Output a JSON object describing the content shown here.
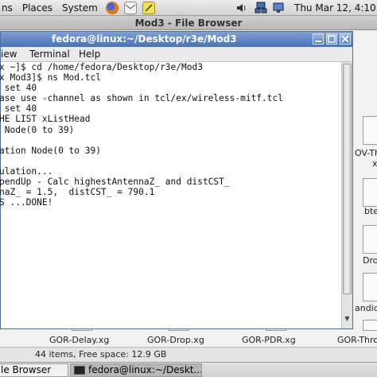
{
  "top_panel": {
    "menus": [
      "ns",
      "Places",
      "System"
    ],
    "clock": "Thu Mar 12,  4:10"
  },
  "file_browser": {
    "title": "Mod3 - File Browser",
    "side_labels": [
      "OV-Th",
      "x",
      "bte",
      "Dro",
      "andic"
    ],
    "file_labels": [
      "GOR-Delay.xg",
      "GOR-Drop.xg",
      "GOR-PDR.xg",
      "GOR-Thro"
    ],
    "status": "44 items, Free space: 12.9 GB"
  },
  "terminal": {
    "title": "fedora@linux:~/Desktop/r3e/Mod3",
    "menus": [
      "iew",
      "Terminal",
      "Help"
    ],
    "lines": [
      "x ~]$ cd /home/fedora/Desktop/r3e/Mod3",
      "x Mod3]$ ns Mod.tcl",
      " set 40",
      "ase use -channel as shown in tcl/ex/wireless-mitf.tcl",
      " set 40",
      "HE LIST xListHead",
      " Node(0 to 39)",
      "",
      "ation Node(0 to 39)",
      "",
      "ulation...",
      "pendUp - Calc highestAntennaZ_ and distCST_",
      "naZ_ = 1.5,  distCST_ = 790.1",
      "S ...DONE!"
    ]
  },
  "taskbar": {
    "file_browser_task": "le Browser",
    "terminal_task": "fedora@linux:~/Deskt..."
  }
}
